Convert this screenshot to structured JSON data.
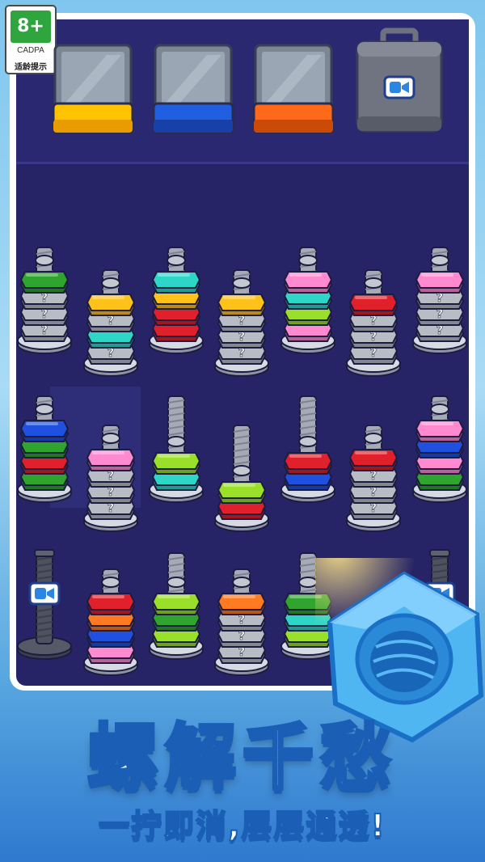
{
  "badge": {
    "age": "8+",
    "org": "CADPA",
    "tip": "适龄提示"
  },
  "slots": [
    {
      "name": "yellow-box",
      "color": "#ffc400",
      "accent": "#e89c00"
    },
    {
      "name": "blue-box",
      "color": "#1f5fe0",
      "accent": "#1740a8"
    },
    {
      "name": "orange-box",
      "color": "#ff6a1a",
      "accent": "#cc4a08"
    },
    {
      "name": "locked-box",
      "locked": true,
      "icon": "video-camera-icon"
    }
  ],
  "unknown_mark": "?",
  "palette": {
    "green": "#2fa42f",
    "yellow": "#ffc21a",
    "teal": "#2ed6c8",
    "red": "#e0202a",
    "pink": "#ff8ad0",
    "blue": "#2050e0",
    "lime": "#9adf2a",
    "orange": "#ff7a20",
    "grey": "#b8bcc4"
  },
  "rows": [
    [
      {
        "nuts": [
          "green",
          "grey",
          "grey",
          "grey"
        ]
      },
      {
        "nuts": [
          "yellow",
          "grey",
          "teal",
          "grey"
        ]
      },
      {
        "nuts": [
          "teal",
          "yellow",
          "red",
          "red"
        ]
      },
      {
        "nuts": [
          "yellow",
          "grey",
          "grey",
          "grey"
        ]
      },
      {
        "nuts": [
          "pink",
          "teal",
          "lime",
          "pink"
        ]
      },
      {
        "nuts": [
          "red",
          "grey",
          "grey",
          "grey"
        ]
      },
      {
        "nuts": [
          "pink",
          "grey",
          "grey",
          "grey"
        ]
      }
    ],
    [
      {
        "nuts": [
          "blue",
          "green",
          "red",
          "green"
        ]
      },
      {
        "nuts": [
          "pink",
          "grey",
          "grey",
          "grey"
        ]
      },
      {
        "nuts": [
          "lime",
          "teal"
        ]
      },
      {
        "nuts": [
          "lime",
          "red"
        ]
      },
      {
        "nuts": [
          "red",
          "blue"
        ]
      },
      {
        "nuts": [
          "red",
          "grey",
          "grey",
          "grey"
        ]
      },
      {
        "nuts": [
          "pink",
          "blue",
          "pink",
          "green"
        ]
      }
    ],
    [
      {
        "nuts": [],
        "locked": true,
        "icon": "video-camera-icon"
      },
      {
        "nuts": [
          "red",
          "orange",
          "blue",
          "pink"
        ]
      },
      {
        "nuts": [
          "lime",
          "green",
          "lime"
        ]
      },
      {
        "nuts": [
          "orange",
          "grey",
          "grey",
          "grey"
        ]
      },
      {
        "nuts": [
          "green",
          "teal",
          "lime"
        ]
      },
      {
        "nuts": [],
        "locked": true,
        "icon": "video-camera-icon"
      }
    ]
  ],
  "headline": "螺解千愁",
  "slogan": "一拧即消,层层通透!"
}
